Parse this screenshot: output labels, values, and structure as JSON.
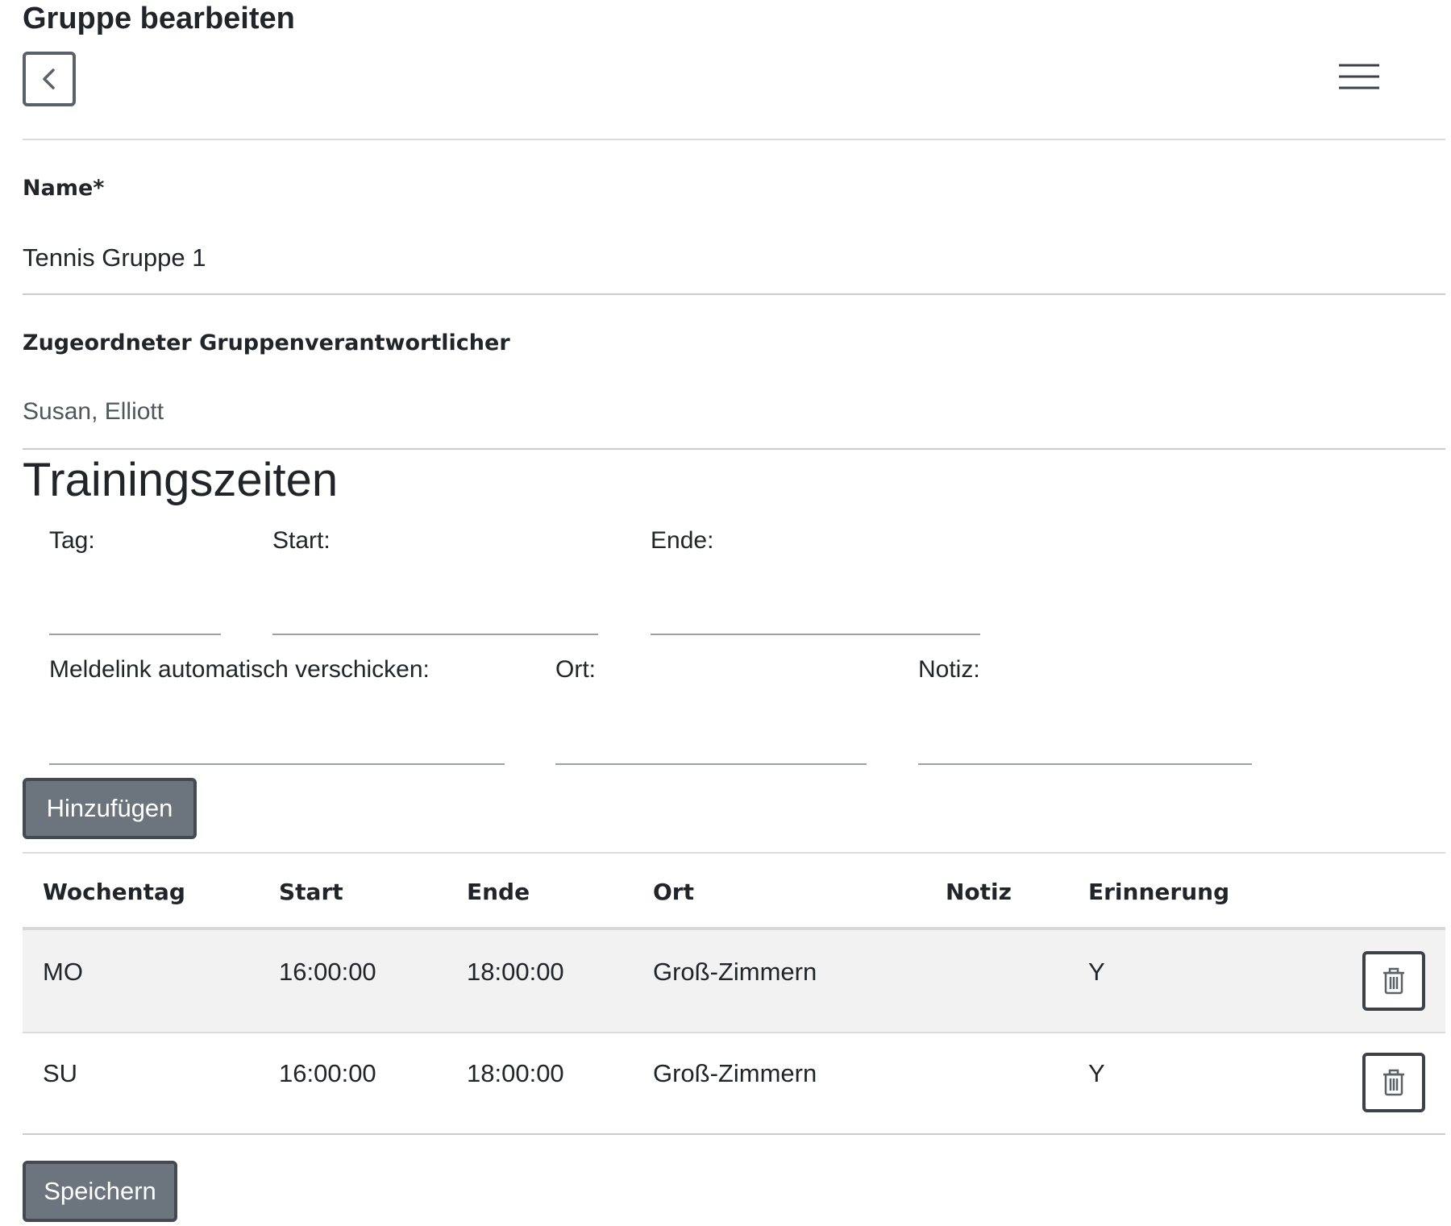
{
  "page": {
    "title": "Gruppe bearbeiten"
  },
  "form": {
    "name_label": "Name*",
    "name_value": "Tennis Gruppe 1",
    "leader_label": "Zugeordneter Gruppenverantwortlicher",
    "leader_value": "Susan, Elliott"
  },
  "training": {
    "heading": "Trainingszeiten",
    "fields": {
      "tag": "Tag:",
      "start": "Start:",
      "ende": "Ende:",
      "meldelink": "Meldelink automatisch verschicken:",
      "ort": "Ort:",
      "notiz": "Notiz:"
    },
    "add_button": "Hinzufügen",
    "table": {
      "columns": [
        "Wochentag",
        "Start",
        "Ende",
        "Ort",
        "Notiz",
        "Erinnerung"
      ],
      "rows": [
        {
          "wochentag": "MO",
          "start": "16:00:00",
          "ende": "18:00:00",
          "ort": "Groß-Zimmern",
          "notiz": "",
          "erinnerung": "Y"
        },
        {
          "wochentag": "SU",
          "start": "16:00:00",
          "ende": "18:00:00",
          "ort": "Groß-Zimmern",
          "notiz": "",
          "erinnerung": "Y"
        }
      ]
    }
  },
  "actions": {
    "save_button": "Speichern"
  },
  "icons": {
    "back": "chevron-left-icon",
    "menu": "hamburger-menu-icon",
    "delete": "trash-icon"
  },
  "colors": {
    "button_secondary": "#6c757d",
    "row_striped": "#f2f2f2",
    "divider": "#d9dcdf"
  }
}
